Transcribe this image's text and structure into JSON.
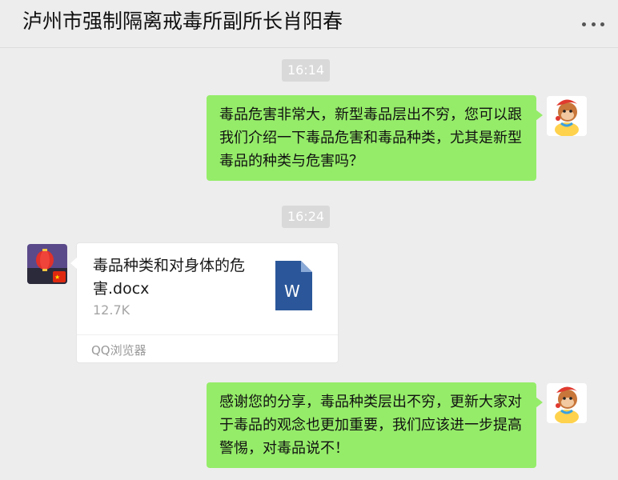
{
  "header": {
    "title": "泸州市强制隔离戒毒所副所长肖阳春",
    "more_icon": "more-dots-icon"
  },
  "messages": [
    {
      "type": "timestamp",
      "text": "16:14"
    },
    {
      "type": "text",
      "side": "right",
      "text": "毒品危害非常大，新型毒品层出不穷，您可以跟我们介绍一下毒品危害和毒品种类，尤其是新型毒品的种类与危害吗？"
    },
    {
      "type": "timestamp",
      "text": "16:24"
    },
    {
      "type": "file",
      "side": "left",
      "file_name": "毒品种类和对身体的危害.docx",
      "file_size": "12.7K",
      "source": "QQ浏览器",
      "file_icon": "word-document-icon",
      "file_icon_letter": "W"
    },
    {
      "type": "text",
      "side": "right",
      "text": "感谢您的分享，毒品种类层出不穷，更新大家对于毒品的观念也更加重要，我们应该进一步提高警惕，对毒品说不！"
    }
  ],
  "colors": {
    "background": "#ededed",
    "bubble_green": "#95ec69",
    "card_white": "#ffffff",
    "word_blue": "#2b579a",
    "timestamp_bg": "#d9d9d9"
  }
}
